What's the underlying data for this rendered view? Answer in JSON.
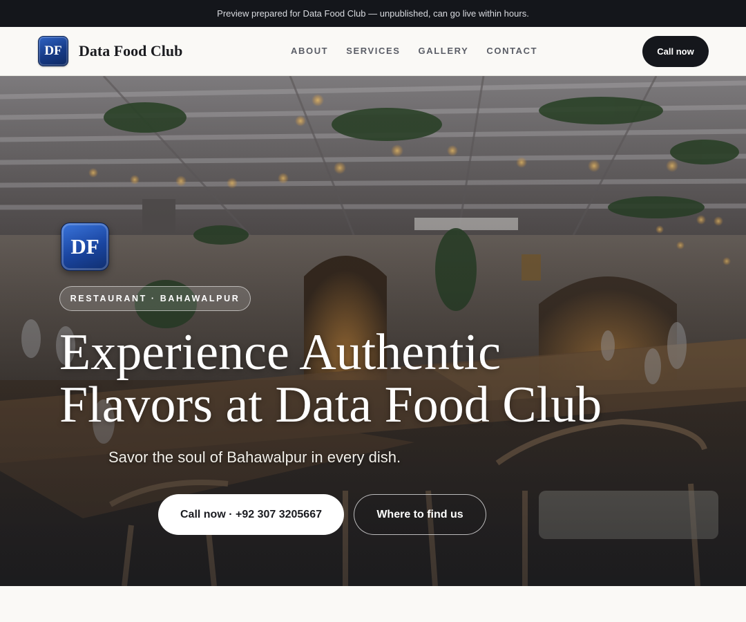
{
  "announcement": "Preview prepared for Data Food Club — unpublished, can go live within hours.",
  "brand": {
    "logo_text": "DF",
    "name": "Data Food Club"
  },
  "nav": {
    "links": [
      "ABOUT",
      "SERVICES",
      "GALLERY",
      "CONTACT"
    ],
    "cta": "Call now"
  },
  "hero": {
    "logo_text": "DF",
    "badge": "RESTAURANT · BAHAWALPUR",
    "title_line1": "Experience Authentic",
    "title_line2": "Flavors at Data Food Club",
    "subtitle": "Savor the soul of Bahawalpur in every dish.",
    "primary_button": "Call now · +92 307 3205667",
    "secondary_button": "Where to find us"
  },
  "colors": {
    "announce_bg": "#14161b",
    "brand_blue": "#1a45a0",
    "cta_dark": "#15171c",
    "page_bg": "#faf9f6"
  }
}
